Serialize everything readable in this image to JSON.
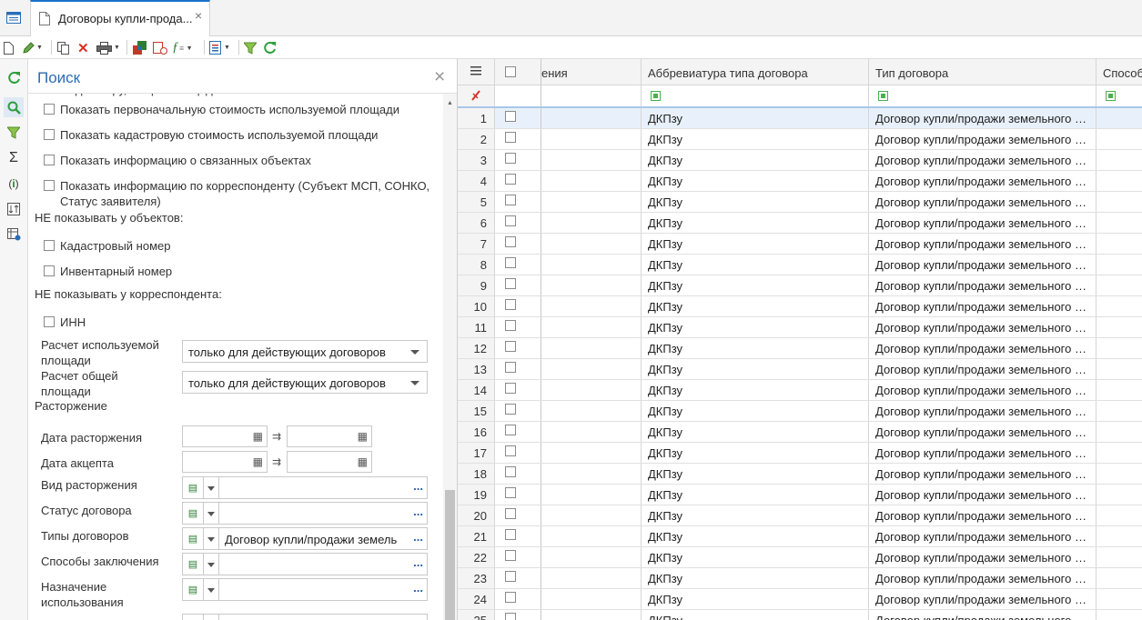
{
  "tab": {
    "title": "Договоры купли-прода...",
    "close": "×"
  },
  "panel": {
    "title": "Поиск",
    "close": "×",
    "cut_text": "по договору, общей площади",
    "checkboxes_top": [
      "Показать первоначальную стоимость используемой площади",
      "Показать кадастровую стоимость используемой площади",
      "Показать информацию о связанных объектах"
    ],
    "correspondent_cb": {
      "line1": "Показать информацию по корреспонденту (Субъект МСП, СОНКО,",
      "line2": "Статус заявителя)"
    },
    "section_objects": "НЕ показывать у объектов:",
    "objects_cbs": [
      "Кадастровый номер",
      "Инвентарный номер"
    ],
    "section_corr": "НЕ показывать у корреспондента:",
    "corr_cbs": [
      "ИНН"
    ],
    "calc_used": {
      "label1": "Расчет используемой",
      "label2": "площади",
      "value": "только для действующих договоров"
    },
    "calc_total": {
      "label1": "Расчет общей",
      "label2": "площади",
      "value": "только для действующих договоров"
    },
    "section_termination": "Расторжение",
    "date_termination": "Дата расторжения",
    "date_accept": "Дата акцепта",
    "lookups": {
      "termination_type": {
        "label": "Вид расторжения",
        "value": ""
      },
      "contract_status": {
        "label": "Статус договора",
        "value": ""
      },
      "contract_types": {
        "label": "Типы договоров",
        "value": "Договор купли/продажи земель"
      },
      "conclusion_methods": {
        "label": "Способы заключения",
        "value": ""
      },
      "purpose": {
        "label1": "Назначение",
        "label2": "использования",
        "value": ""
      }
    },
    "dots": "..."
  },
  "grid": {
    "headers": {
      "partial": "ения",
      "abbr": "Аббревиатура типа договора",
      "type": "Тип договора",
      "method": "Способ"
    },
    "rows": [
      {
        "n": "1",
        "abbr": "ДКПзу",
        "type": "Договор купли/продажи земельного участка"
      },
      {
        "n": "2",
        "abbr": "ДКПзу",
        "type": "Договор купли/продажи земельного участка"
      },
      {
        "n": "3",
        "abbr": "ДКПзу",
        "type": "Договор купли/продажи земельного участка"
      },
      {
        "n": "4",
        "abbr": "ДКПзу",
        "type": "Договор купли/продажи земельного участка"
      },
      {
        "n": "5",
        "abbr": "ДКПзу",
        "type": "Договор купли/продажи земельного участка"
      },
      {
        "n": "6",
        "abbr": "ДКПзу",
        "type": "Договор купли/продажи земельного участка"
      },
      {
        "n": "7",
        "abbr": "ДКПзу",
        "type": "Договор купли/продажи земельного участка"
      },
      {
        "n": "8",
        "abbr": "ДКПзу",
        "type": "Договор купли/продажи земельного участка"
      },
      {
        "n": "9",
        "abbr": "ДКПзу",
        "type": "Договор купли/продажи земельного участка"
      },
      {
        "n": "10",
        "abbr": "ДКПзу",
        "type": "Договор купли/продажи земельного участка"
      },
      {
        "n": "11",
        "abbr": "ДКПзу",
        "type": "Договор купли/продажи земельного участка"
      },
      {
        "n": "12",
        "abbr": "ДКПзу",
        "type": "Договор купли/продажи земельного участка"
      },
      {
        "n": "13",
        "abbr": "ДКПзу",
        "type": "Договор купли/продажи земельного участка"
      },
      {
        "n": "14",
        "abbr": "ДКПзу",
        "type": "Договор купли/продажи земельного участка"
      },
      {
        "n": "15",
        "abbr": "ДКПзу",
        "type": "Договор купли/продажи земельного участка"
      },
      {
        "n": "16",
        "abbr": "ДКПзу",
        "type": "Договор купли/продажи земельного участка"
      },
      {
        "n": "17",
        "abbr": "ДКПзу",
        "type": "Договор купли/продажи земельного участка"
      },
      {
        "n": "18",
        "abbr": "ДКПзу",
        "type": "Договор купли/продажи земельного участка"
      },
      {
        "n": "19",
        "abbr": "ДКПзу",
        "type": "Договор купли/продажи земельного участка"
      },
      {
        "n": "20",
        "abbr": "ДКПзу",
        "type": "Договор купли/продажи земельного участка"
      },
      {
        "n": "21",
        "abbr": "ДКПзу",
        "type": "Договор купли/продажи земельного участка"
      },
      {
        "n": "22",
        "abbr": "ДКПзу",
        "type": "Договор купли/продажи земельного участка"
      },
      {
        "n": "23",
        "abbr": "ДКПзу",
        "type": "Договор купли/продажи земельного участка"
      },
      {
        "n": "24",
        "abbr": "ДКПзу",
        "type": "Договор купли/продажи земельного участка"
      },
      {
        "n": "25",
        "abbr": "ДКПзу",
        "type": "Договор купли/продажи земельного участка"
      }
    ]
  }
}
